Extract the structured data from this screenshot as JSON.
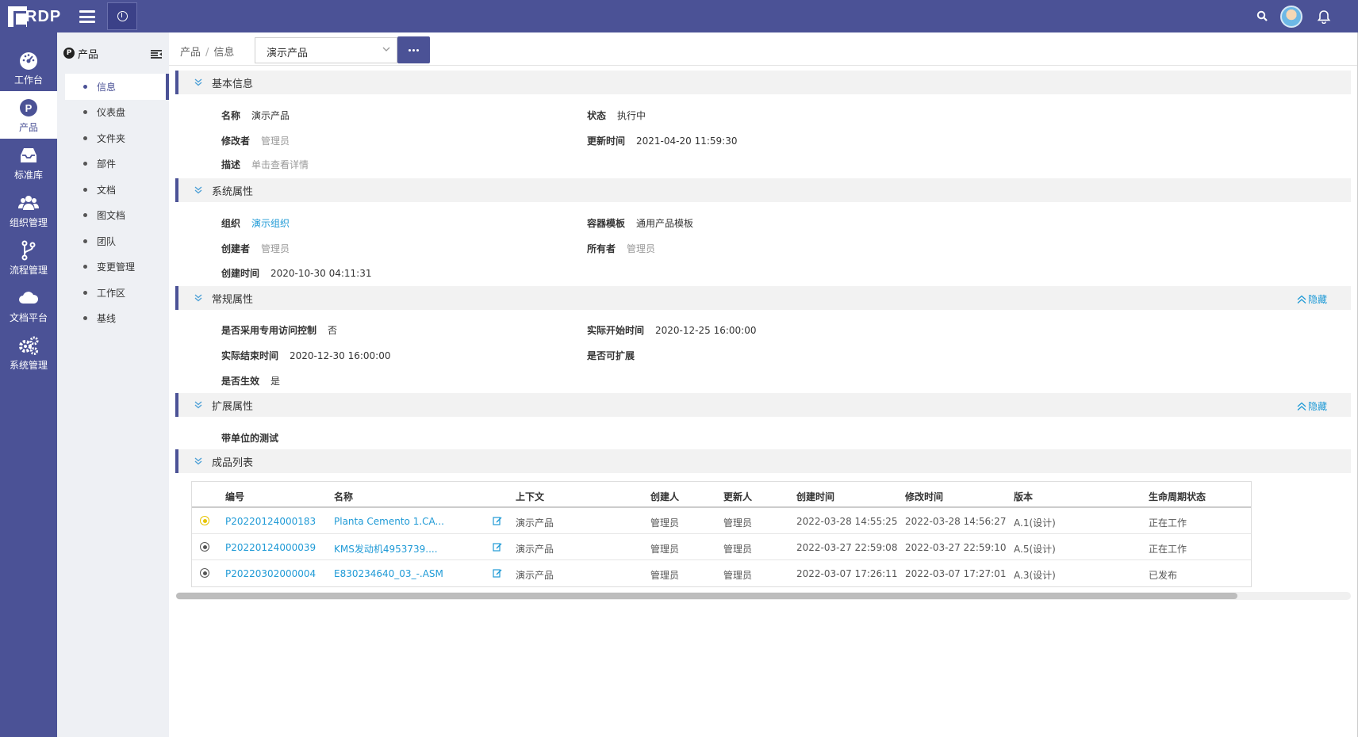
{
  "app": {
    "logo_text": "RDP",
    "accent": "#4b5296",
    "link_color": "#1f9ad6"
  },
  "leftnav": {
    "items": [
      {
        "label": "工作台",
        "icon": "dashboard-icon"
      },
      {
        "label": "产品",
        "icon": "product-icon",
        "active": true
      },
      {
        "label": "标准库",
        "icon": "inbox-icon"
      },
      {
        "label": "组织管理",
        "icon": "users-icon"
      },
      {
        "label": "流程管理",
        "icon": "branch-icon"
      },
      {
        "label": "文档平台",
        "icon": "cloud-icon"
      },
      {
        "label": "系统管理",
        "icon": "gears-icon"
      }
    ]
  },
  "subnav": {
    "title": "产品",
    "items": [
      {
        "label": "信息",
        "active": true
      },
      {
        "label": "仪表盘"
      },
      {
        "label": "文件夹"
      },
      {
        "label": "部件"
      },
      {
        "label": "文档"
      },
      {
        "label": "图文档"
      },
      {
        "label": "团队"
      },
      {
        "label": "变更管理"
      },
      {
        "label": "工作区"
      },
      {
        "label": "基线"
      }
    ]
  },
  "breadcrumb": {
    "level1": "产品",
    "level2": "信息",
    "separator": "/"
  },
  "product_select": {
    "value": "演示产品"
  },
  "sections": {
    "basic": {
      "title": "基本信息",
      "name_label": "名称",
      "name_value": "演示产品",
      "status_label": "状态",
      "status_value": "执行中",
      "modifier_label": "修改者",
      "modifier_value": "管理员",
      "updated_label": "更新时间",
      "updated_value": "2021-04-20 11:59:30",
      "desc_label": "描述",
      "desc_value": "单击查看详情"
    },
    "system": {
      "title": "系统属性",
      "org_label": "组织",
      "org_value": "演示组织",
      "template_label": "容器模板",
      "template_value": "通用产品模板",
      "creator_label": "创建者",
      "creator_value": "管理员",
      "owner_label": "所有者",
      "owner_value": "管理员",
      "created_label": "创建时间",
      "created_value": "2020-10-30 04:11:31"
    },
    "general": {
      "title": "常规属性",
      "hide_label": "隐藏",
      "access_label": "是否采用专用访问控制",
      "access_value": "否",
      "start_label": "实际开始时间",
      "start_value": "2020-12-25 16:00:00",
      "end_label": "实际结束时间",
      "end_value": "2020-12-30 16:00:00",
      "extend_label": "是否可扩展",
      "extend_value": "",
      "effective_label": "是否生效",
      "effective_value": "是"
    },
    "extended": {
      "title": "扩展属性",
      "hide_label": "隐藏",
      "unit_test_label": "带单位的测试"
    },
    "products": {
      "title": "成品列表",
      "columns": [
        "编号",
        "名称",
        "上下文",
        "创建人",
        "更新人",
        "创建时间",
        "修改时间",
        "版本",
        "生命周期状态"
      ],
      "rows": [
        {
          "number": "P20220124000183",
          "name": "Planta Cemento 1.CA...",
          "context": "演示产品",
          "creator": "管理员",
          "updater": "管理员",
          "created": "2022-03-28 14:55:25",
          "modified": "2022-03-28 14:56:27",
          "version": "A.1(设计)",
          "state": "正在工作"
        },
        {
          "number": "P20220124000039",
          "name": "KMS发动机4953739....",
          "context": "演示产品",
          "creator": "管理员",
          "updater": "管理员",
          "created": "2022-03-27 22:59:08",
          "modified": "2022-03-27 22:59:10",
          "version": "A.5(设计)",
          "state": "正在工作"
        },
        {
          "number": "P20220302000004",
          "name": "E830234640_03_-.ASM",
          "context": "演示产品",
          "creator": "管理员",
          "updater": "管理员",
          "created": "2022-03-07 17:26:11",
          "modified": "2022-03-07 17:27:01",
          "version": "A.3(设计)",
          "state": "已发布"
        }
      ]
    }
  }
}
